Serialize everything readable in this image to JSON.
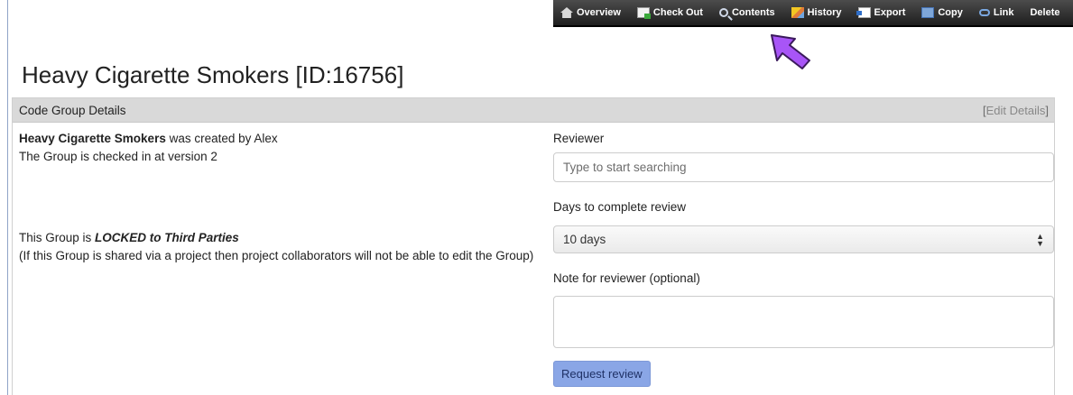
{
  "toolbar": {
    "items": [
      {
        "label": "Overview",
        "icon": "home-icon"
      },
      {
        "label": "Check Out",
        "icon": "checkout-icon"
      },
      {
        "label": "Contents",
        "icon": "search-icon"
      },
      {
        "label": "History",
        "icon": "history-icon"
      },
      {
        "label": "Export",
        "icon": "export-icon"
      },
      {
        "label": "Copy",
        "icon": "copy-icon"
      },
      {
        "label": "Link",
        "icon": "link-icon"
      },
      {
        "label": "Delete",
        "icon": ""
      }
    ]
  },
  "annotation": {
    "icon": "pointer-arrow-icon",
    "color": "#a855f7"
  },
  "page": {
    "title": "Heavy Cigarette Smokers [ID:16756]"
  },
  "panel": {
    "header": "Code Group Details",
    "edit_bracket_open": "[",
    "edit_label": "Edit Details",
    "edit_bracket_close": "]"
  },
  "details": {
    "group_name": "Heavy Cigarette Smokers",
    "created_by_text": " was created by Alex",
    "version_text": "The Group is checked in at version 2",
    "lock_prefix": "This Group is ",
    "lock_status": "LOCKED to Third Parties",
    "lock_note": "(If this Group is shared via a project then project collaborators will not be able to edit the Group)"
  },
  "review": {
    "reviewer_label": "Reviewer",
    "reviewer_placeholder": "Type to start searching",
    "days_label": "Days to complete review",
    "days_value": "10 days",
    "note_label": "Note for reviewer (optional)",
    "request_button": "Request review"
  },
  "colors": {
    "accent": "#8aa6e6",
    "toolbar_bg": "#2b2b2b",
    "panel_header": "#d9d9d9"
  }
}
